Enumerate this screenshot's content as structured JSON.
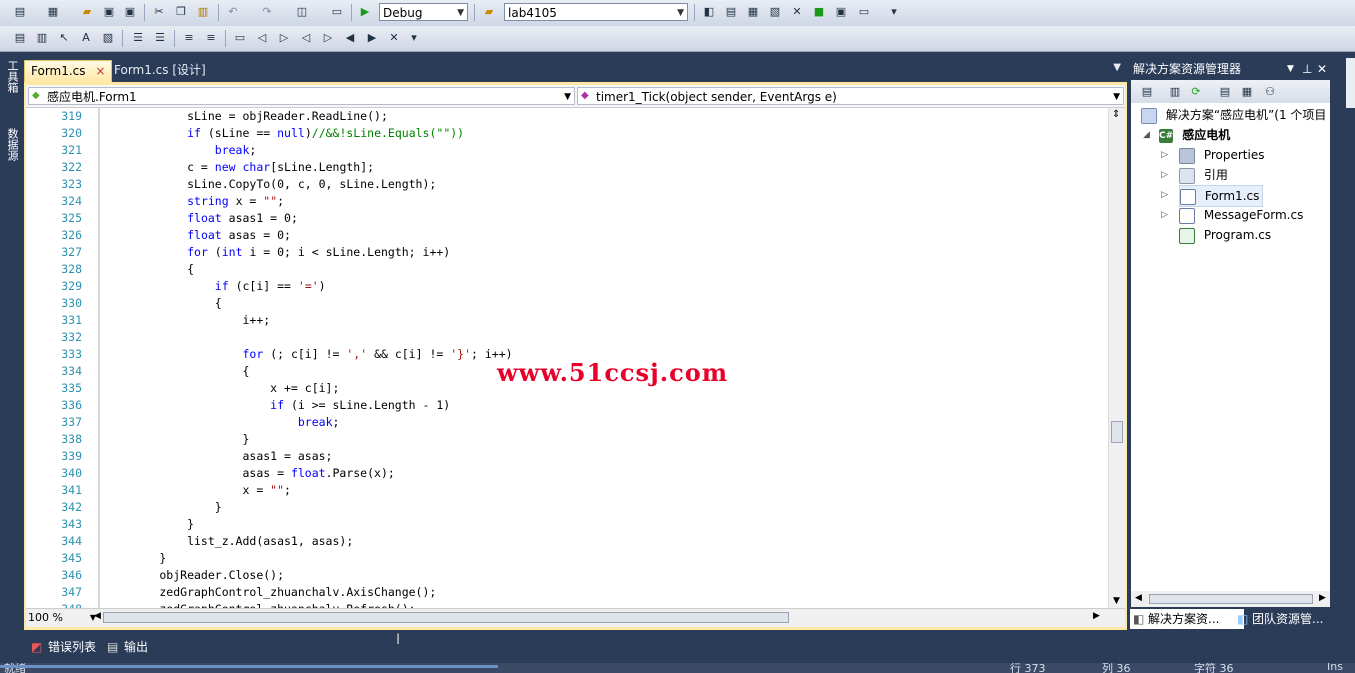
{
  "toolbar": {
    "config_combo": "Debug",
    "project_combo": "lab4105"
  },
  "side_tabs": {
    "toolbox": "工具箱",
    "datasource": "数据源"
  },
  "doc_tabs": [
    {
      "label": "Form1.cs",
      "close": "×"
    },
    {
      "label": "Form1.cs [设计]"
    }
  ],
  "nav": {
    "class_combo": "感应电机.Form1",
    "member_combo": "timer1_Tick(object sender, EventArgs e)"
  },
  "code": {
    "lines": [
      {
        "n": "319",
        "html": "            sLine = objReader.ReadLine();"
      },
      {
        "n": "320",
        "html": "            <span class='kw'>if</span> (sLine == <span class='kw'>null</span>)<span class='cm'>//&&!sLine.Equals(\"\"))</span>"
      },
      {
        "n": "321",
        "html": "                <span class='kw'>break</span>;"
      },
      {
        "n": "322",
        "html": "            c = <span class='kw'>new</span> <span class='kw'>char</span>[sLine.Length];"
      },
      {
        "n": "323",
        "html": "            sLine.CopyTo(0, c, 0, sLine.Length);"
      },
      {
        "n": "324",
        "html": "            <span class='kw'>string</span> x = <span class='st'>\"\"</span>;"
      },
      {
        "n": "325",
        "html": "            <span class='kw'>float</span> asas1 = 0;"
      },
      {
        "n": "326",
        "html": "            <span class='kw'>float</span> asas = 0;"
      },
      {
        "n": "327",
        "html": "            <span class='kw'>for</span> (<span class='kw'>int</span> i = 0; i &lt; sLine.Length; i++)"
      },
      {
        "n": "328",
        "html": "            {"
      },
      {
        "n": "329",
        "html": "                <span class='kw'>if</span> (c[i] == <span class='st'>'='</span>)"
      },
      {
        "n": "330",
        "html": "                {"
      },
      {
        "n": "331",
        "html": "                    i++;"
      },
      {
        "n": "332",
        "html": ""
      },
      {
        "n": "333",
        "html": "                    <span class='kw'>for</span> (; c[i] != <span class='st'>','</span> && c[i] != <span class='st'>'}'</span>; i++)"
      },
      {
        "n": "334",
        "html": "                    {"
      },
      {
        "n": "335",
        "html": "                        x += c[i];"
      },
      {
        "n": "336",
        "html": "                        <span class='kw'>if</span> (i >= sLine.Length - 1)"
      },
      {
        "n": "337",
        "html": "                            <span class='kw'>break</span>;"
      },
      {
        "n": "338",
        "html": "                    }"
      },
      {
        "n": "339",
        "html": "                    asas1 = asas;"
      },
      {
        "n": "340",
        "html": "                    asas = <span class='kw'>float</span>.Parse(x);"
      },
      {
        "n": "341",
        "html": "                    x = <span class='st'>\"\"</span>;"
      },
      {
        "n": "342",
        "html": "                }"
      },
      {
        "n": "343",
        "html": "            }"
      },
      {
        "n": "344",
        "html": "            list_z.Add(asas1, asas);"
      },
      {
        "n": "345",
        "html": "        }"
      },
      {
        "n": "346",
        "html": "        objReader.Close();"
      },
      {
        "n": "347",
        "html": "        zedGraphControl_zhuanchalv.AxisChange();"
      },
      {
        "n": "348",
        "html": "        zedGraphControl_zhuanchalv.Refresh();"
      }
    ]
  },
  "zoom": "100 %",
  "solution_explorer": {
    "title": "解决方案资源管理器",
    "items": [
      {
        "label": "解决方案“感应电机”(1 个项目"
      },
      {
        "label": "感应电机"
      },
      {
        "label": "Properties"
      },
      {
        "label": "引用"
      },
      {
        "label": "Form1.cs"
      },
      {
        "label": "MessageForm.cs"
      },
      {
        "label": "Program.cs"
      }
    ],
    "tabs": [
      "解决方案资...",
      "团队资源管..."
    ]
  },
  "bottom_tabs": [
    "错误列表",
    "输出"
  ],
  "status": {
    "left": "就绪",
    "line": "行 373",
    "col": "列 36",
    "ch": "字符 36",
    "mode": "Ins"
  },
  "watermark": "www.51ccsj.com"
}
